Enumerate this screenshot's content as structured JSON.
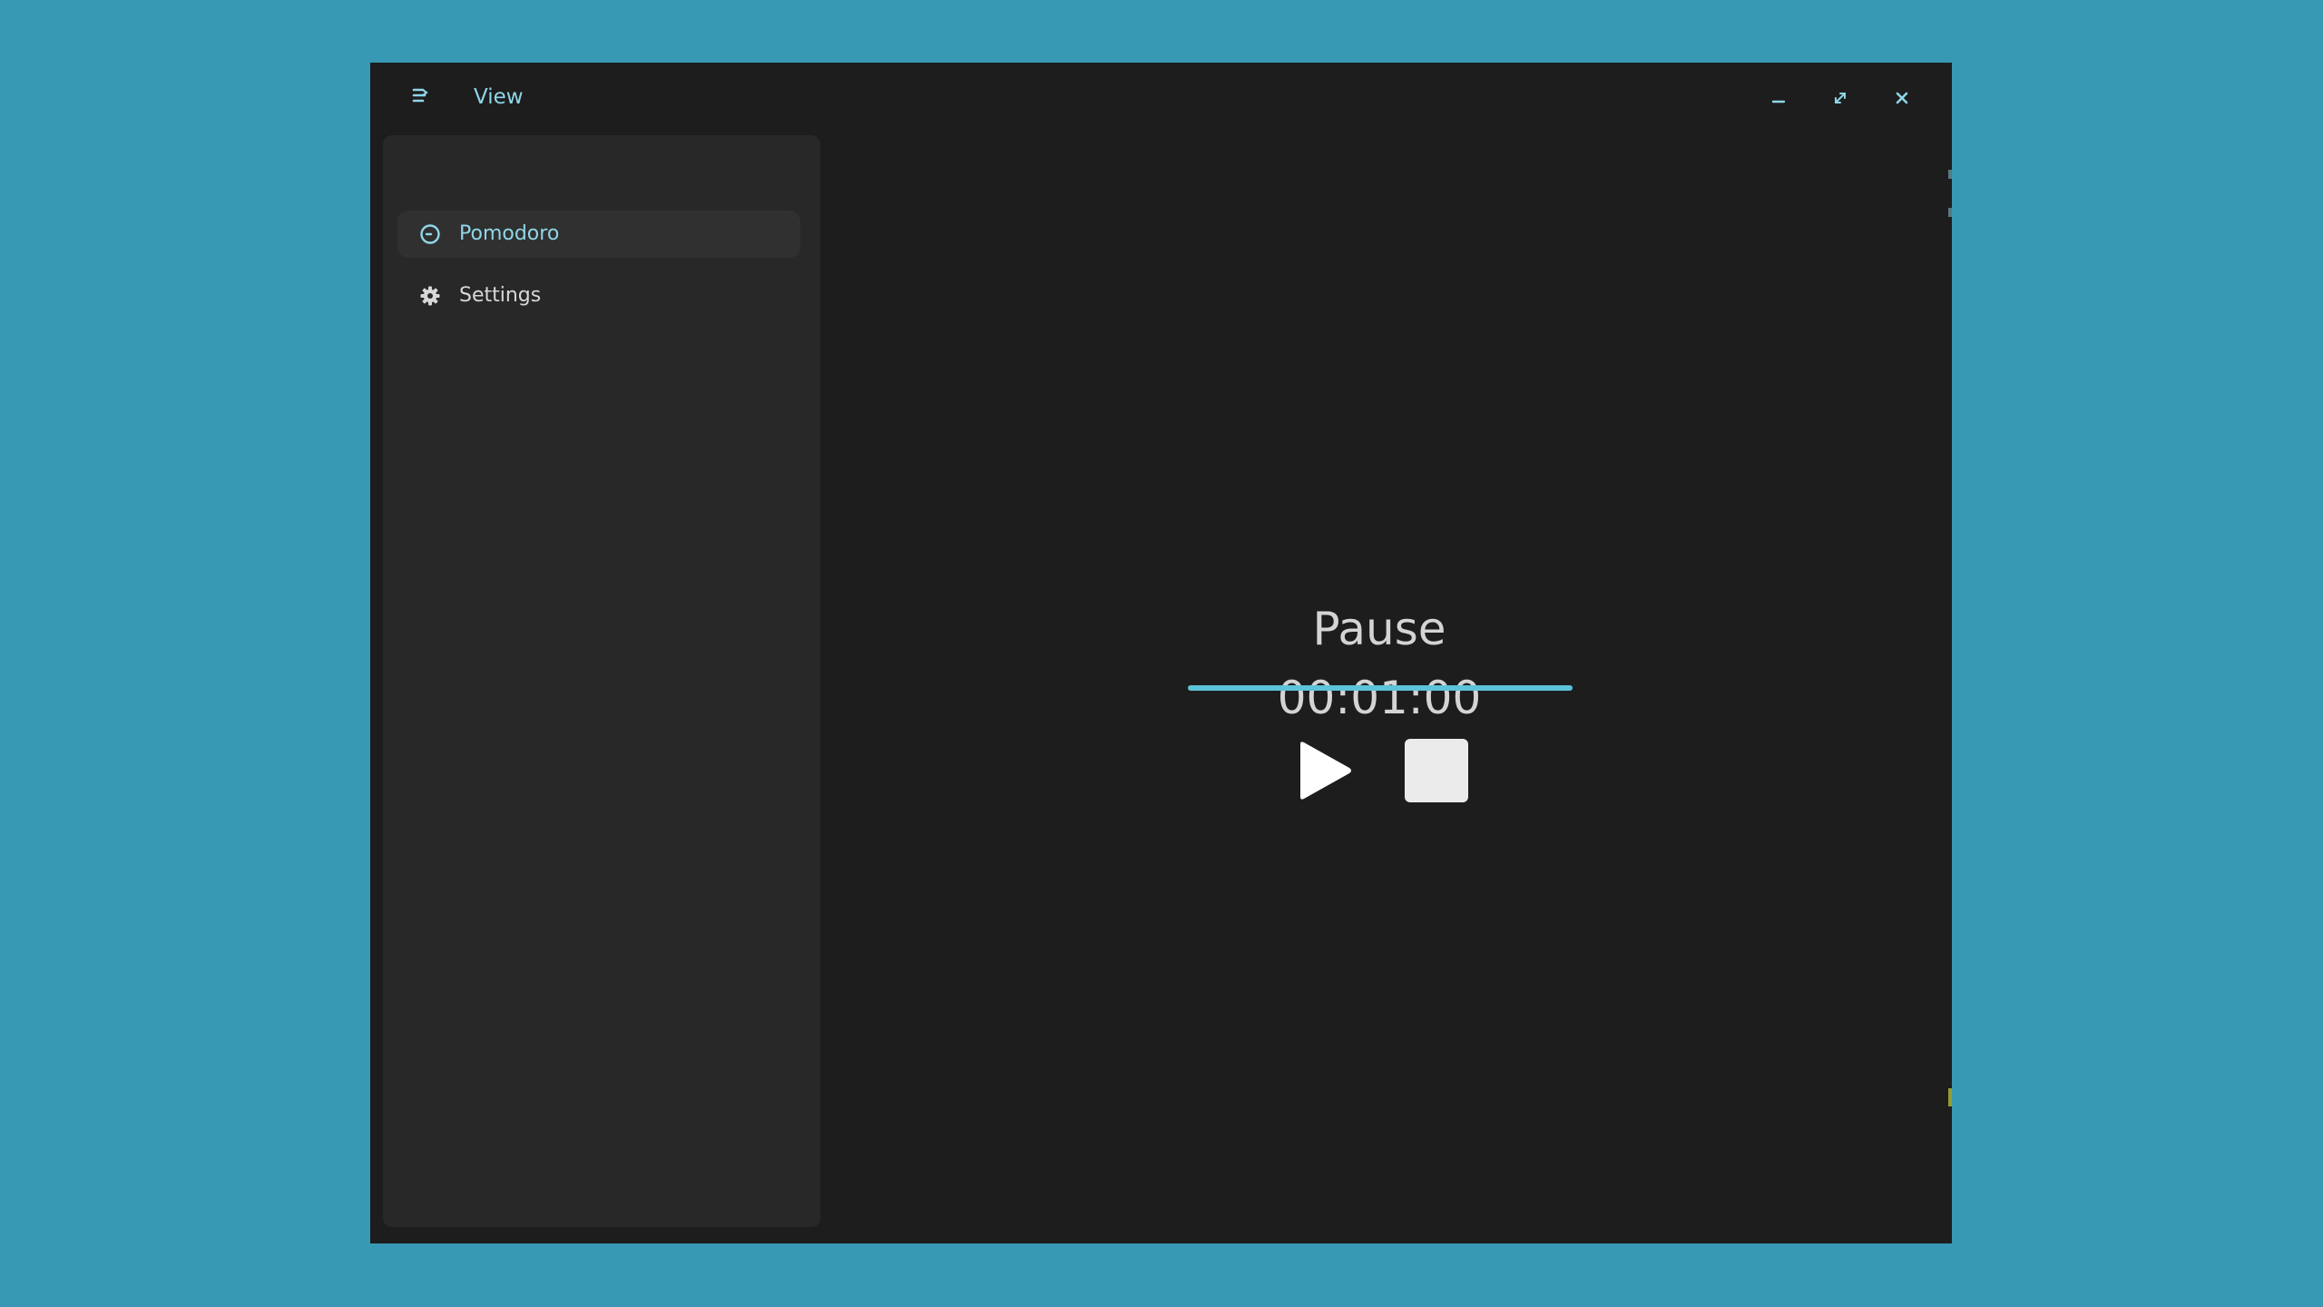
{
  "window": {
    "menu": {
      "view_label": "View"
    },
    "controls": {
      "minimize_icon": "minimize-icon",
      "maximize_icon": "maximize-icon",
      "close_icon": "close-icon"
    }
  },
  "sidebar": {
    "items": [
      {
        "label": "Pomodoro",
        "icon": "clock-icon",
        "active": true
      },
      {
        "label": "Settings",
        "icon": "gear-icon",
        "active": false
      }
    ]
  },
  "timer": {
    "state_label": "Pause",
    "time": "00:01:00",
    "progress_percent": 100
  },
  "controls": {
    "play_icon": "play-icon",
    "stop_icon": "stop-icon"
  },
  "colors": {
    "desktop": "#3899b5",
    "window_bg": "#1d1d1d",
    "sidebar_bg": "#282828",
    "accent": "#8fd6e8",
    "progress": "#5cc3d8",
    "text": "#d4d4d4"
  }
}
